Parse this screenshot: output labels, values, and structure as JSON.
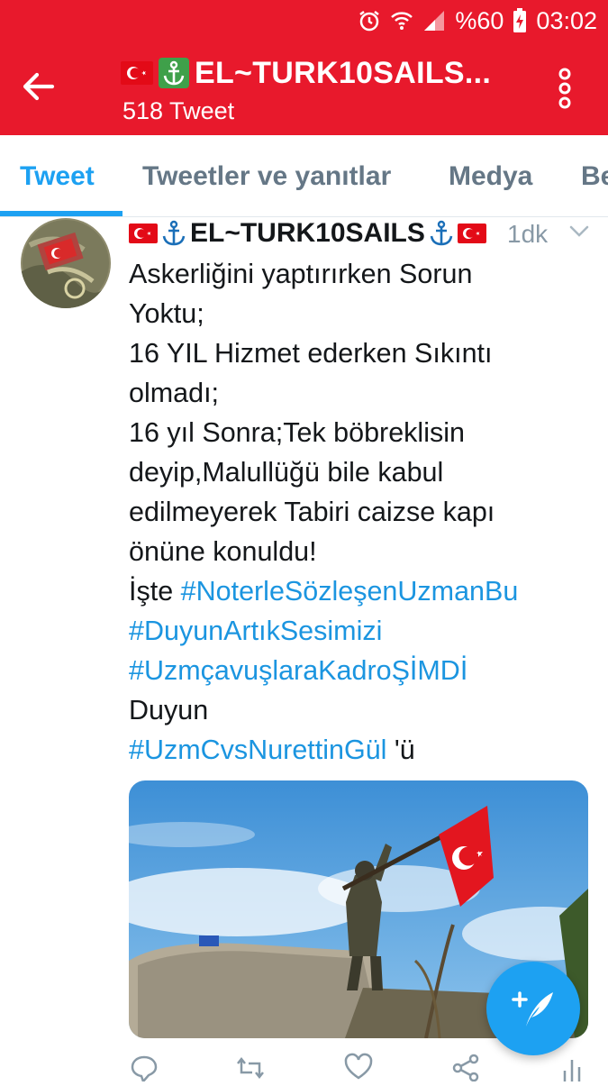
{
  "status_bar": {
    "battery_percent": "%60",
    "time": "03:02",
    "icons": [
      "alarm-icon",
      "wifi-icon",
      "signal-icon",
      "battery-charging-icon"
    ]
  },
  "app_bar": {
    "back_icon": "arrow-left-icon",
    "title": "EL~TURK10SAILS...",
    "title_emoji": [
      "turkish-flag-icon",
      "anchor-icon"
    ],
    "subtitle": "518 Tweet",
    "menu_icon": "more-vertical-icon",
    "background_color": "#e8192c"
  },
  "tabs": [
    {
      "label": "Tweet",
      "active": true
    },
    {
      "label": "Tweetler ve yanıtlar",
      "active": false
    },
    {
      "label": "Medya",
      "active": false
    },
    {
      "label": "Be",
      "active": false
    }
  ],
  "tweet": {
    "author_name": "EL~TURK10SAILS",
    "time": "1dk",
    "text_lines": [
      "Askerliğini yaptırırken Sorun",
      "Yoktu;",
      "16 YIL Hizmet ederken Sıkıntı",
      "olmadı;",
      "16 yıl Sonra;Tek böbreklisin",
      "deyip,Malullüğü bile kabul",
      "edilmeyerek Tabiri caizse kapı",
      "önüne konuldu!"
    ],
    "line_iste_prefix": "İşte ",
    "hashtag_1": "#NoterleSözleşenUzmanBu",
    "hashtag_2": "#DuyunArtıkSesimizi",
    "hashtag_3": "#UzmçavuşlaraKadroŞİMDİ",
    "text_duyun": "Duyun",
    "hashtag_4": "#UzmCvsNurettinGül",
    "suffix_after_hashtag_4": " 'ü",
    "actions": [
      "reply-icon",
      "retweet-icon",
      "like-icon",
      "share-icon",
      "analytics-icon"
    ]
  },
  "fab": {
    "icon": "compose-tweet-icon",
    "color": "#1da1f2"
  },
  "colors": {
    "accent": "#1da1f2",
    "hashtag": "#1b95e0",
    "secondary_text": "#657786"
  }
}
